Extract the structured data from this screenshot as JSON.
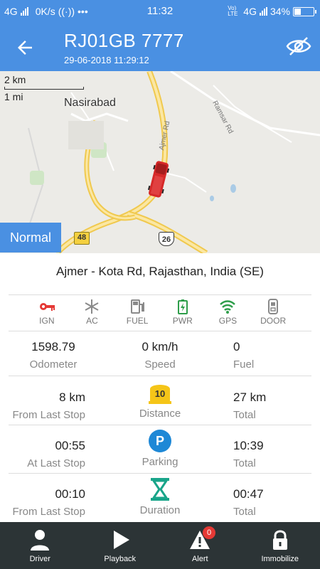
{
  "status_bar": {
    "network_left": "4G",
    "data_rate": "0K/s",
    "time": "11:32",
    "volte": "Vo) LTE",
    "network_right": "4G",
    "battery": "34%",
    "battery_level": 0.34
  },
  "header": {
    "title": "RJ01GB 7777",
    "subtitle": "29-06-2018 11:29:12"
  },
  "map": {
    "scale_km": "2 km",
    "scale_mi": "1 mi",
    "place_label": "Nasirabad",
    "road_label_1": "Ajmer Rd",
    "road_label_2": "Ramsar Rd",
    "shield_48": "48",
    "shield_26": "26",
    "mode": "Normal"
  },
  "address": "Ajmer - Kota Rd, Rajasthan,  India (SE)",
  "status_icons": [
    {
      "label": "IGN",
      "color": "#e53935"
    },
    {
      "label": "AC",
      "color": "#8a8a8a"
    },
    {
      "label": "FUEL",
      "color": "#8a8a8a"
    },
    {
      "label": "PWR",
      "color": "#2e9e4a"
    },
    {
      "label": "GPS",
      "color": "#2e9e4a"
    },
    {
      "label": "DOOR",
      "color": "#8a8a8a"
    }
  ],
  "rows": [
    {
      "left_val": "1598.79",
      "left_cap": "Odometer",
      "mid_val": "0 km/h",
      "mid_cap": "Speed",
      "right_val": "0",
      "right_cap": "Fuel"
    },
    {
      "left_val": "8 km",
      "left_cap": "From Last Stop",
      "mid_icon_text": "10",
      "mid_cap": "Distance",
      "right_val": "27 km",
      "right_cap": "Total"
    },
    {
      "left_val": "00:55",
      "left_cap": "At Last Stop",
      "mid_icon_text": "P",
      "mid_cap": "Parking",
      "right_val": "10:39",
      "right_cap": "Total"
    },
    {
      "left_val": "00:10",
      "left_cap": "From Last Stop",
      "mid_cap": "Duration",
      "right_val": "00:47",
      "right_cap": "Total"
    }
  ],
  "bottom_nav": {
    "driver": "Driver",
    "playback": "Playback",
    "alert": "Alert",
    "alert_count": "0",
    "immobilize": "Immobilize"
  },
  "colors": {
    "primary": "#4a90e2",
    "nav_bg": "#2c3436",
    "distance_yellow": "#f5c518",
    "parking_blue": "#1e88d6",
    "duration_green": "#19a58a"
  }
}
